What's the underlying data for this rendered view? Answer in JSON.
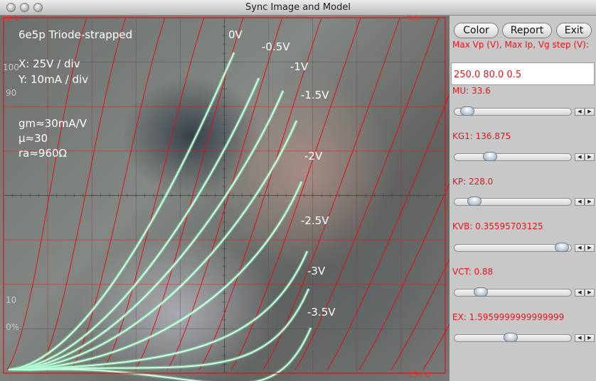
{
  "window": {
    "title": "Sync Image and Model"
  },
  "plot": {
    "title": "6e5p Triode-strapped",
    "xscale": "X: 25V / div",
    "yscale": "Y: 10mA / div",
    "gm": "gm≈30mA/V",
    "mu": "μ≈30",
    "ra": "ra≈960Ω",
    "corner_top_left": "80.0",
    "corner_top_right": "0.5",
    "corner_bottom_right": "250.0",
    "scope_marks": [
      "100",
      "90",
      "10",
      "0%"
    ],
    "curve_labels": [
      "0V",
      "-0.5V",
      "-1V",
      "-1.5V",
      "-2V",
      "-2.5V",
      "-3V",
      "-3.5V"
    ],
    "colors": {
      "grid": "#e01010",
      "trace": "#d4ffe4",
      "label": "#ffffff"
    }
  },
  "panel": {
    "buttons": {
      "color": "Color",
      "report": "Report",
      "exit": "Exit"
    },
    "params_label": "Max Vp (V), Max Ip, Vg step (V):",
    "params_value": "250.0 80.0 0.5",
    "sliders": [
      {
        "label": "MU: 33.6",
        "fraction": 0.06
      },
      {
        "label": "KG1: 136.875",
        "fraction": 0.28
      },
      {
        "label": "KP: 228.0",
        "fraction": 0.13
      },
      {
        "label": "KVB: 0.35595703125",
        "fraction": 0.97
      },
      {
        "label": "VCT: 0.88",
        "fraction": 0.19
      },
      {
        "label": "EX: 1.5959999999999999",
        "fraction": 0.48
      }
    ],
    "colors": {
      "label": "#e8141b"
    }
  }
}
